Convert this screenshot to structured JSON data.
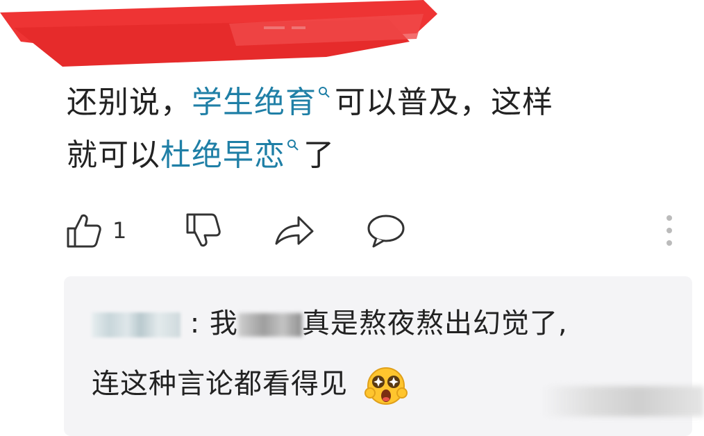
{
  "comment": {
    "text_part1": "还别说，",
    "keyword1": "学生绝育",
    "text_part2": "可以普及，这样",
    "text_part3": "就可以",
    "keyword2": "杜绝早恋",
    "text_part4": "了",
    "keyword_color": "#1f7fa6"
  },
  "actions": {
    "like_count": "1",
    "icons": [
      "thumbs-up-icon",
      "thumbs-down-icon",
      "share-icon",
      "comment-icon",
      "more-icon"
    ]
  },
  "reply": {
    "colon": ":",
    "line1_a": "我",
    "line1_b": "真是熬夜熬出幻觉了,",
    "line2": "连这种言论都看得见",
    "emoji": "star-eyes-emoji"
  },
  "colors": {
    "redaction": "#ea2f2f",
    "reply_background": "#f4f4f6"
  }
}
